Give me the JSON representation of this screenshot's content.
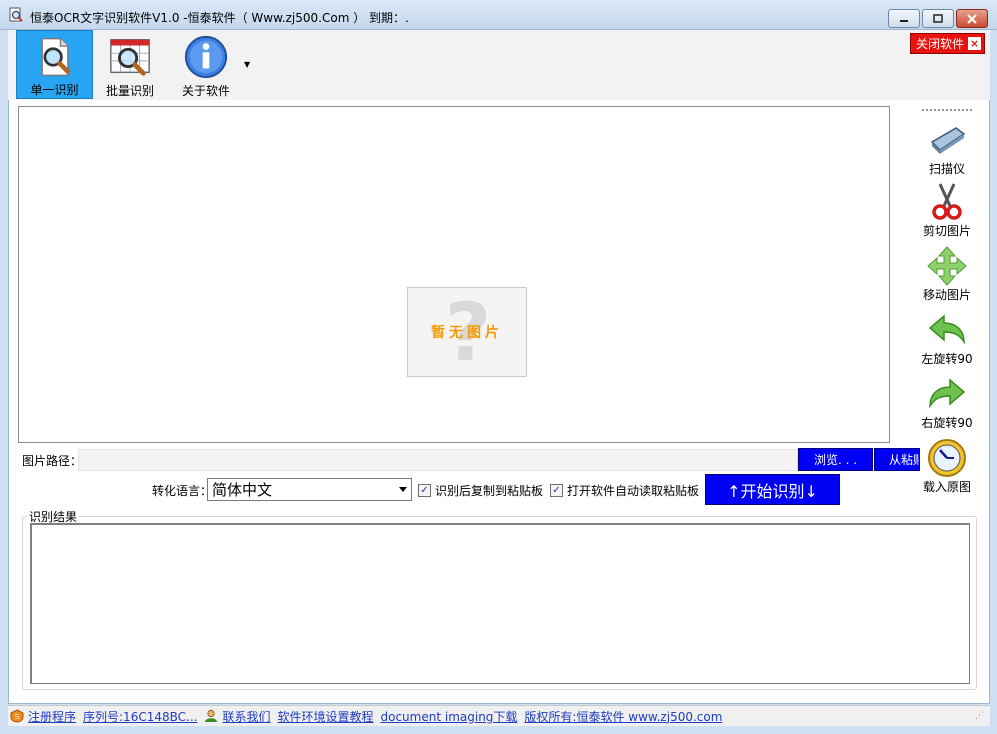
{
  "window": {
    "title": "恒泰OCR文字识别软件V1.0 -恒泰软件（ Www.zj500.Com ） 到期：.",
    "controls": [
      "minimize",
      "maximize",
      "close"
    ]
  },
  "toolbar": {
    "items": [
      {
        "label": "单一识别",
        "icon": "magnifier-doc-icon",
        "active": true
      },
      {
        "label": "批量识别",
        "icon": "magnifier-grid-icon"
      },
      {
        "label": "关于软件",
        "icon": "info-icon"
      }
    ],
    "close_software_label": "关闭软件"
  },
  "image_panel": {
    "placeholder_text": "暂无图片"
  },
  "right_tools": [
    {
      "label": "扫描仪",
      "icon": "scanner-icon"
    },
    {
      "label": "剪切图片",
      "icon": "scissors-icon"
    },
    {
      "label": "移动图片",
      "icon": "move-icon"
    },
    {
      "label": "左旋转90",
      "icon": "rotate-left-icon"
    },
    {
      "label": "右旋转90",
      "icon": "rotate-right-icon"
    },
    {
      "label": "载入原图",
      "icon": "clock-icon"
    }
  ],
  "path_row": {
    "label": "图片路径：",
    "value": "",
    "browse_label": "浏览. . .",
    "paste_label": "从粘贴板"
  },
  "options": {
    "language_label": "转化语言：",
    "language_value": "简体中文",
    "copy_to_clipboard_label": "识别后复制到粘贴板",
    "copy_to_clipboard_checked": true,
    "auto_read_clipboard_label": "打开软件自动读取粘贴板",
    "auto_read_clipboard_checked": true,
    "start_label": "↑开始识别↓"
  },
  "result": {
    "label": "识别结果",
    "text": ""
  },
  "statusbar": {
    "register": "注册程序",
    "serial": "序列号:16C148BC...",
    "contact": "联系我们",
    "env_tutorial": "软件环境设置教程",
    "download": "document imaging下载",
    "copyright": "版权所有:恒泰软件 www.zj500.com"
  }
}
